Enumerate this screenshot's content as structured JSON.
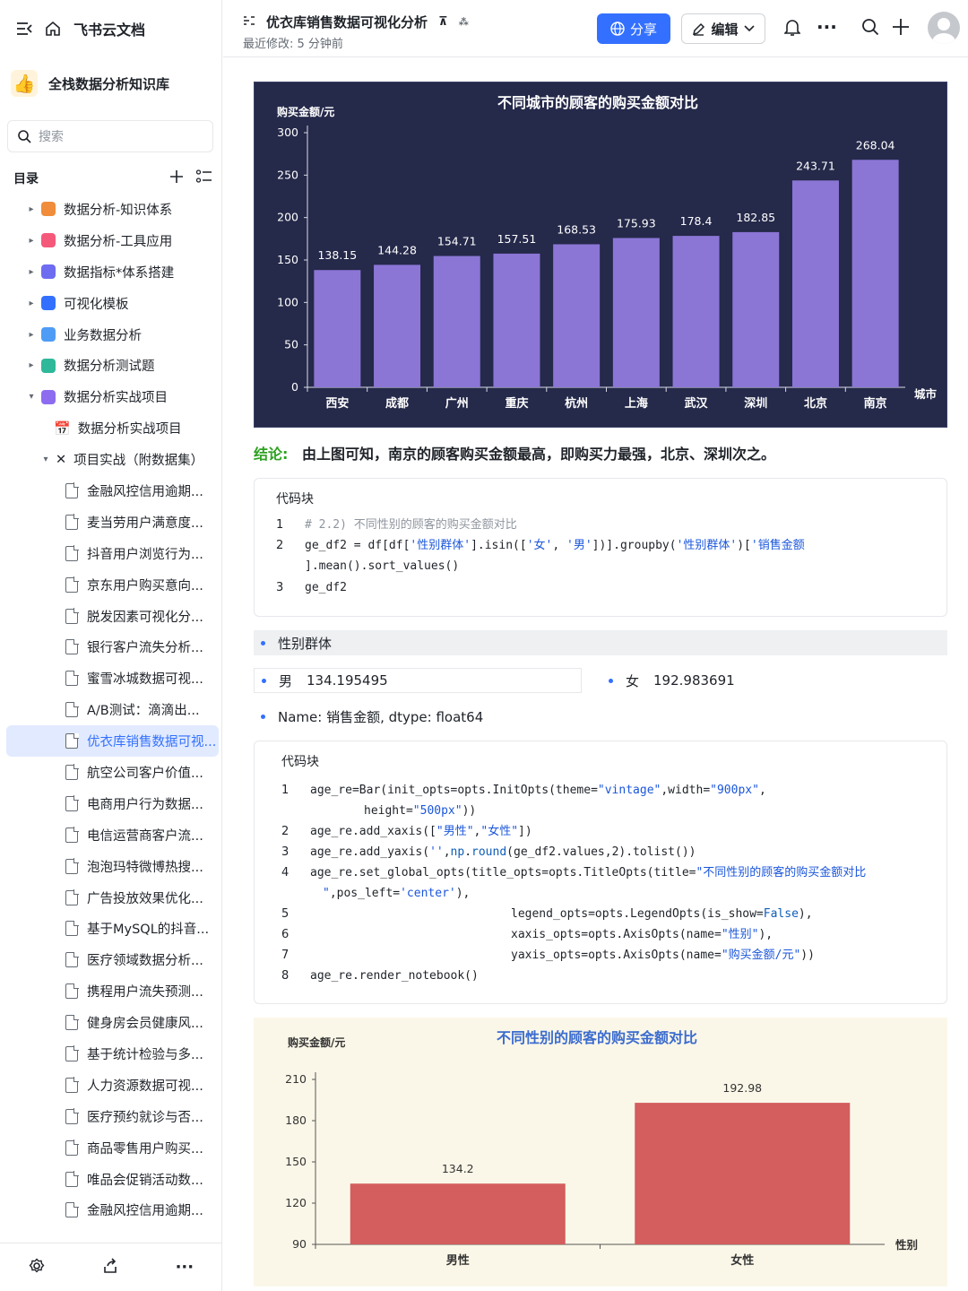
{
  "sidebar": {
    "app_name": "飞书云文档",
    "knowledge_base": "全栈数据分析知识库",
    "search_placeholder": "搜索",
    "toc_label": "目录",
    "items": [
      {
        "label": "数据分析-知识体系",
        "color": "#f08c3a"
      },
      {
        "label": "数据分析-工具应用",
        "color": "#f5597a"
      },
      {
        "label": "数据指标*体系搭建",
        "color": "#6e6cf0"
      },
      {
        "label": "可视化模板",
        "color": "#3370ff"
      },
      {
        "label": "业务数据分析",
        "color": "#4e9cf5"
      },
      {
        "label": "数据分析测试题",
        "color": "#2fb89a"
      },
      {
        "label": "数据分析实战项目",
        "color": "#8d6cf0"
      },
      {
        "label": "数据分析实战项目"
      },
      {
        "label": "项目实战（附数据集）"
      }
    ],
    "docs": [
      "金融风控信用逾期...",
      "麦当劳用户满意度...",
      "抖音用户浏览行为...",
      "京东用户购买意向...",
      "脱发因素可视化分...",
      "银行客户流失分析...",
      "蜜雪冰城数据可视...",
      "A/B测试：滴滴出...",
      "优衣库销售数据可视...",
      "航空公司客户价值...",
      "电商用户行为数据...",
      "电信运营商客户流...",
      "泡泡玛特微博热搜...",
      "广告投放效果优化...",
      "基于MySQL的抖音...",
      "医疗领域数据分析...",
      "携程用户流失预测...",
      "健身房会员健康风...",
      "基于统计检验与多...",
      "人力资源数据可视...",
      "医疗预约就诊与否...",
      "商品零售用户购买...",
      "唯品会促销活动数...",
      "金融风控信用逾期..."
    ],
    "selected_doc_index": 8
  },
  "topbar": {
    "title": "优衣库销售数据可视化分析",
    "modified": "最近修改: 5 分钟前",
    "share": "分享",
    "edit": "编辑"
  },
  "chart1": {
    "title": "不同城市的顾客的购买金额对比",
    "ylabel": "购买金额/元",
    "xlabel": "城市"
  },
  "conclusion": {
    "label": "结论:",
    "text": "由上图可知，南京的顾客购买金额最高，即购买力最强，北京、深圳次之。"
  },
  "code1": {
    "header": "代码块",
    "lines": [
      {
        "n": "1",
        "html": "<span class='cm'># 2.2) 不同性别的顾客的购买金额对比</span>"
      },
      {
        "n": "2",
        "html": "ge_df2 = df[df[<span class='s'>'性别群体'</span>].isin([<span class='s'>'女'</span>, <span class='s'>'男'</span>])].groupby(<span class='s'>'性别群体'</span>)[<span class='s'>'销售金额</span>"
      },
      {
        "n": "",
        "html": "].mean().sort_values()"
      },
      {
        "n": "3",
        "html": "ge_df2"
      }
    ]
  },
  "output": {
    "group_label": "性别群体",
    "male_label": "男",
    "male_value": "134.195495",
    "female_label": "女",
    "female_value": "192.983691",
    "name_line": "Name: 销售金额, dtype: float64"
  },
  "code2": {
    "header": "代码块",
    "lines": [
      {
        "n": "1",
        "pad": 0,
        "html": "age_re=Bar(init_opts=opts.InitOpts(theme=<span class='s'>\"vintage\"</span>,width=<span class='s'>\"900px\"</span>,"
      },
      {
        "n": "",
        "pad": 60,
        "html": "height=<span class='s'>\"500px\"</span>))"
      },
      {
        "n": "2",
        "pad": 0,
        "html": "age_re.add_xaxis([<span class='s'>\"男性\"</span>,<span class='s'>\"女性\"</span>])"
      },
      {
        "n": "3",
        "pad": 0,
        "html": "age_re.add_yaxis(<span class='s'>''</span>,<span class='k'>np</span>.<span class='k'>round</span>(ge_df2.values,2).tolist())"
      },
      {
        "n": "4",
        "pad": 0,
        "html": "age_re.set_global_opts(title_opts=opts.TitleOpts(title=<span class='s'>\"不同性别的顾客的购买金额对比</span>"
      },
      {
        "n": "",
        "pad": 14,
        "html": "<span class='s'>\"</span>,pos_left=<span class='s'>'center'</span>),"
      },
      {
        "n": "5",
        "pad": 224,
        "html": "legend_opts=opts.LegendOpts(is_show=<span class='k'>False</span>),"
      },
      {
        "n": "6",
        "pad": 224,
        "html": "xaxis_opts=opts.AxisOpts(name=<span class='s'>\"性别\"</span>),"
      },
      {
        "n": "7",
        "pad": 224,
        "html": "yaxis_opts=opts.AxisOpts(name=<span class='s'>\"购买金额/元\"</span>))"
      },
      {
        "n": "8",
        "pad": 0,
        "html": "age_re.render_notebook()"
      }
    ]
  },
  "chart2": {
    "title": "不同性别的顾客的购买金额对比",
    "ylabel": "购买金额/元",
    "xlabel": "性别"
  },
  "chart_data": [
    {
      "type": "bar",
      "title": "不同城市的顾客的购买金额对比",
      "ylabel": "购买金额/元",
      "xlabel": "城市",
      "categories": [
        "西安",
        "成都",
        "广州",
        "重庆",
        "杭州",
        "上海",
        "武汉",
        "深圳",
        "北京",
        "南京"
      ],
      "values": [
        138.15,
        144.28,
        154.71,
        157.51,
        168.53,
        175.93,
        178.4,
        182.85,
        243.71,
        268.04
      ],
      "yticks": [
        0,
        50,
        100,
        150,
        200,
        250,
        300
      ],
      "ylim": [
        0,
        300
      ],
      "bar_color": "#8b76d6",
      "background": "#25294a"
    },
    {
      "type": "bar",
      "title": "不同性别的顾客的购买金额对比",
      "ylabel": "购买金额/元",
      "xlabel": "性别",
      "categories": [
        "男性",
        "女性"
      ],
      "values": [
        134.2,
        192.98
      ],
      "yticks": [
        90,
        120,
        150,
        180,
        210
      ],
      "ylim": [
        90,
        210
      ],
      "bar_color": "#d45d5d",
      "background": "#fbf7e8"
    }
  ]
}
